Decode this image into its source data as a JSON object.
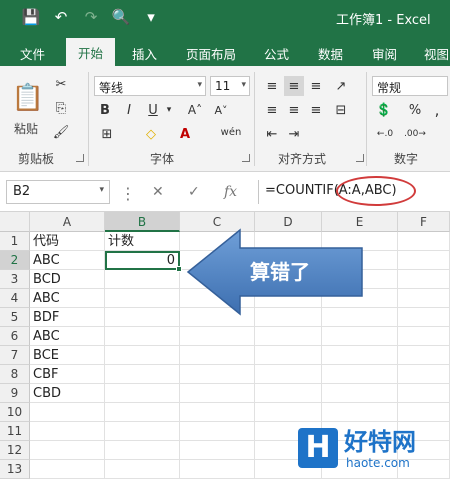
{
  "window": {
    "title": "工作簿1 - Excel"
  },
  "tabs": [
    "文件",
    "开始",
    "插入",
    "页面布局",
    "公式",
    "数据",
    "审阅",
    "视图"
  ],
  "ribbon": {
    "paste_label": "粘贴",
    "font_name": "等线",
    "font_size": "11",
    "bold": "B",
    "italic": "I",
    "underline": "U",
    "wen": "wén",
    "number_format": "常规",
    "groups": [
      "剪贴板",
      "字体",
      "对齐方式",
      "数字"
    ]
  },
  "formula_bar": {
    "name_box": "B2",
    "fx": "fx",
    "formula": "=COUNTIF(A:A,ABC)"
  },
  "sheet": {
    "columns": [
      "A",
      "B",
      "C",
      "D",
      "E",
      "F"
    ],
    "rows": [
      "1",
      "2",
      "3",
      "4",
      "5",
      "6",
      "7",
      "8",
      "9",
      "10",
      "11",
      "12",
      "13"
    ],
    "cells_a": [
      "代码",
      "ABC",
      "BCD",
      "ABC",
      "BDF",
      "ABC",
      "BCE",
      "CBF",
      "CBD"
    ],
    "b1": "计数",
    "b2": "0"
  },
  "callout": {
    "text": "算错了"
  },
  "watermark": {
    "name": "好特网",
    "url": "haote.com"
  },
  "colors": {
    "accent": "#217346",
    "arrow": "#4f81bd",
    "circle": "#d13b3b"
  }
}
